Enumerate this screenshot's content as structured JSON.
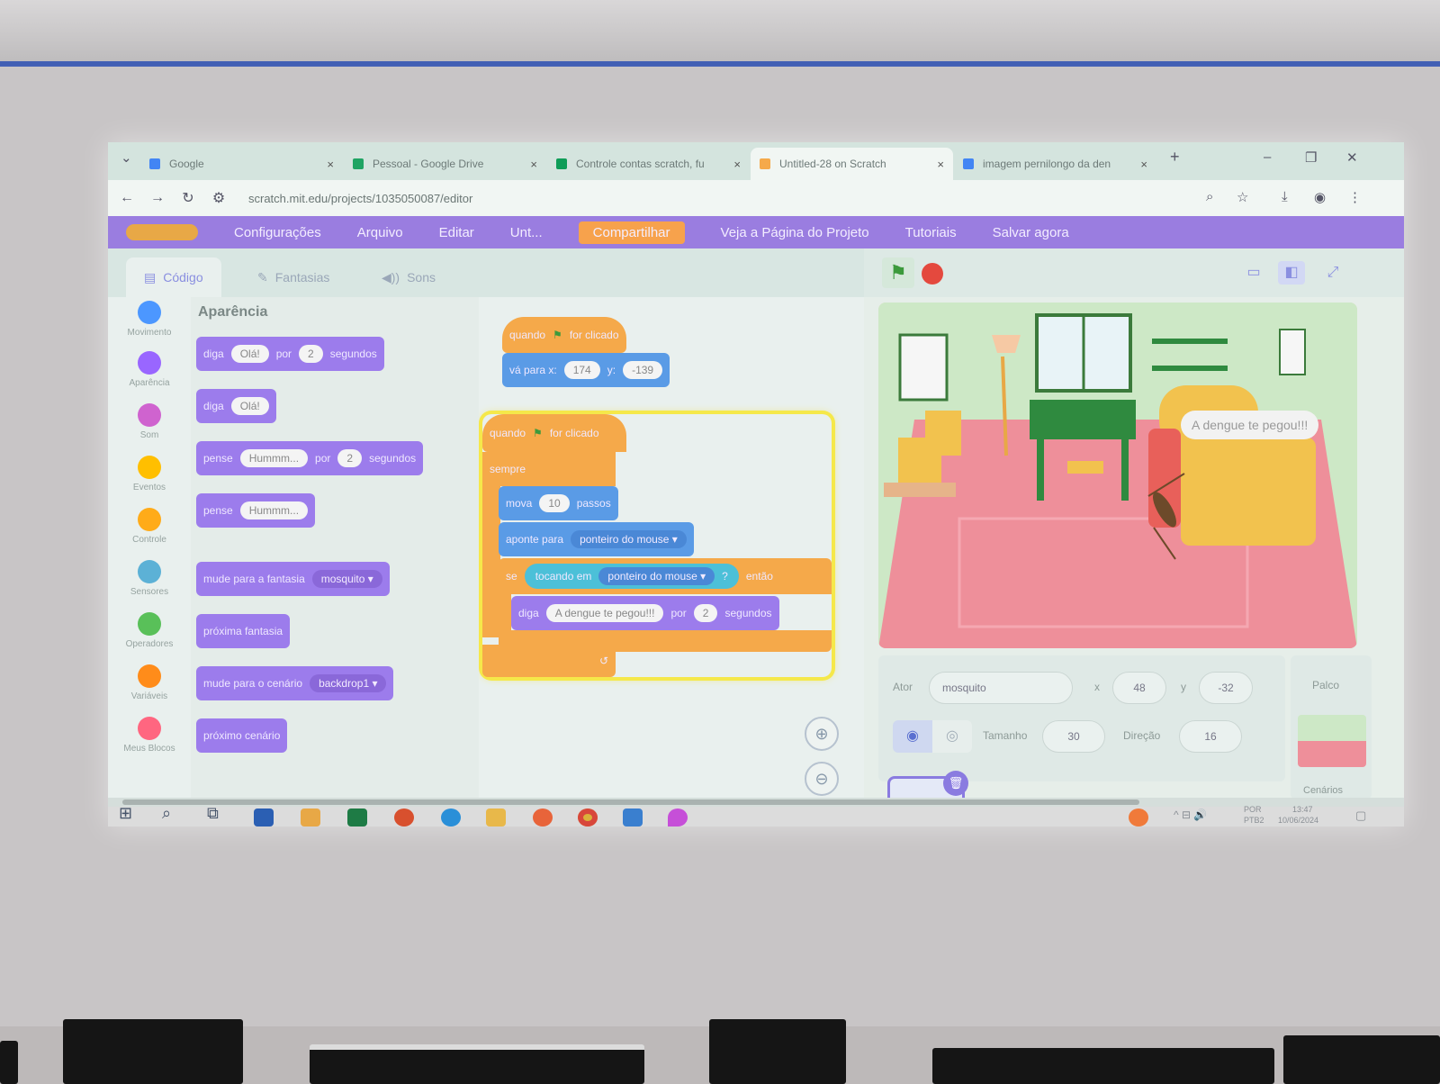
{
  "browser": {
    "tabs": [
      {
        "title": "Google",
        "color": "#4285f4"
      },
      {
        "title": "Pessoal - Google Drive",
        "color": "#1fa463"
      },
      {
        "title": "Controle contas scratch, fu",
        "color": "#0f9d58"
      },
      {
        "title": "Untitled-28 on Scratch",
        "color": "#f5a94a"
      },
      {
        "title": "imagem pernilongo da den",
        "color": "#4285f4"
      }
    ],
    "close_glyph": "×",
    "new_tab_glyph": "+",
    "url": "scratch.mit.edu/projects/1035050087/editor"
  },
  "scratch_menu": {
    "settings": "Configurações",
    "file": "Arquivo",
    "edit": "Editar",
    "title_field": "Unt...",
    "share": "Compartilhar",
    "project_page": "Veja a Página do Projeto",
    "tutorials": "Tutoriais",
    "save": "Salvar agora"
  },
  "editor_tabs": {
    "code": "Código",
    "costumes": "Fantasias",
    "sounds": "Sons"
  },
  "categories": [
    {
      "label": "Movimento",
      "color": "#4c97ff"
    },
    {
      "label": "Aparência",
      "color": "#9966ff"
    },
    {
      "label": "Som",
      "color": "#cf63cf"
    },
    {
      "label": "Eventos",
      "color": "#ffbf00"
    },
    {
      "label": "Controle",
      "color": "#ffab19"
    },
    {
      "label": "Sensores",
      "color": "#5cb1d6"
    },
    {
      "label": "Operadores",
      "color": "#59c059"
    },
    {
      "label": "Variáveis",
      "color": "#ff8c1a"
    },
    {
      "label": "Meus Blocos",
      "color": "#ff6680"
    }
  ],
  "palette": {
    "title": "Aparência",
    "say_for": {
      "word": "diga",
      "text": "Olá!",
      "por": "por",
      "secs": "2",
      "unit": "segundos"
    },
    "say": {
      "word": "diga",
      "text": "Olá!"
    },
    "think_for": {
      "word": "pense",
      "text": "Hummm...",
      "por": "por",
      "secs": "2",
      "unit": "segundos"
    },
    "think": {
      "word": "pense",
      "text": "Hummm..."
    },
    "switch_costume": {
      "label": "mude para a fantasia",
      "value": "mosquito"
    },
    "next_costume": "próxima fantasia",
    "switch_backdrop": {
      "label": "mude para o cenário",
      "value": "backdrop1"
    },
    "next_backdrop": "próximo cenário"
  },
  "script1": {
    "hat": "quando",
    "hat_end": "for clicado",
    "goto": "vá para x:",
    "x": "174",
    "y_label": "y:",
    "y": "-139"
  },
  "script2": {
    "hat": "quando",
    "hat_end": "for clicado",
    "forever": "sempre",
    "move": "mova",
    "steps": "10",
    "steps_unit": "passos",
    "point": "aponte para",
    "point_target": "ponteiro do mouse",
    "if": "se",
    "touching": "tocando em",
    "touching_target": "ponteiro do mouse",
    "question": "?",
    "then": "então",
    "say": "diga",
    "say_text": "A dengue te pegou!!!",
    "por": "por",
    "secs": "2",
    "unit": "segundos",
    "loop_arrow": "↺"
  },
  "stage": {
    "bubble": "A dengue te pegou!!!",
    "flag_glyph": "⚑"
  },
  "sprite_info": {
    "actor_label": "Ator",
    "actor": "mosquito",
    "x_label": "x",
    "x": "48",
    "y_label": "y",
    "y": "-32",
    "size_label": "Tamanho",
    "size": "30",
    "direction_label": "Direção",
    "direction": "16",
    "stage_label": "Palco",
    "backdrops_label": "Cenários"
  },
  "taskbar": {
    "lang": "POR",
    "layout": "PTB2",
    "time": "13:47",
    "date": "10/06/2024"
  }
}
